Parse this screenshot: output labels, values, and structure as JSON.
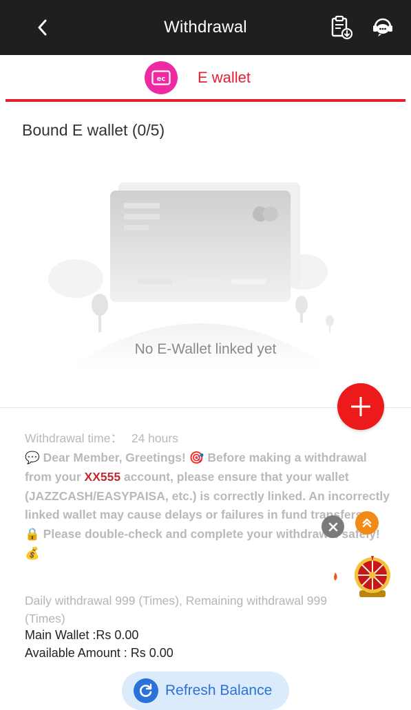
{
  "header": {
    "title": "Withdrawal"
  },
  "tabs": [
    {
      "label": "E wallet"
    }
  ],
  "bound": {
    "label": "Bound E wallet (0/5)"
  },
  "empty_state": {
    "text": "No E-Wallet linked yet"
  },
  "info": {
    "withdrawal_time_label": "Withdrawal time：",
    "withdrawal_time_value": "24 hours",
    "notice_part1": " Dear Member, Greetings! ",
    "notice_part2": " Before making a withdrawal from your ",
    "account": "XX555",
    "notice_part3": " account, please ensure that your wallet (JAZZCASH/EASYPAISA, etc.) is correctly linked. An incorrectly linked wallet may cause delays or failures in fund transfers.",
    "notice_part4": " Please double-check and complete your withdrawal safely! "
  },
  "limits": {
    "text": "Daily withdrawal 999 (Times), Remaining withdrawal 999 (Times)"
  },
  "wallet": {
    "main": "Main Wallet :Rs 0.00",
    "available": "Available Amount : Rs 0.00"
  },
  "refresh": {
    "label": "Refresh Balance"
  },
  "colors": {
    "accent": "#e5202e",
    "tab_icon": "#ee2aa3",
    "add_button": "#ec1a1a",
    "refresh": "#2a71d8"
  }
}
